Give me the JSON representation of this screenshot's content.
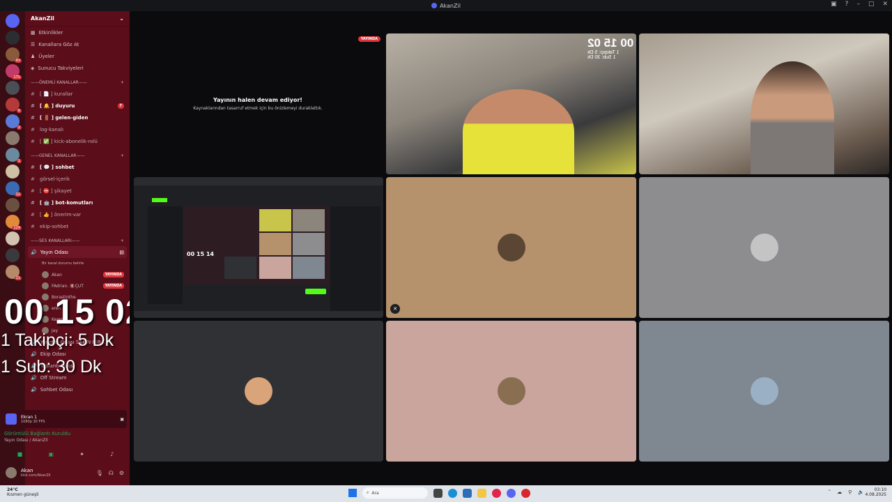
{
  "window": {
    "title": "AkanZil"
  },
  "servers": [
    {
      "badge": ""
    },
    {
      "badge": ""
    },
    {
      "badge": "43"
    },
    {
      "badge": "175"
    },
    {
      "badge": ""
    },
    {
      "badge": "6"
    },
    {
      "badge": "2"
    },
    {
      "badge": ""
    },
    {
      "badge": "1"
    },
    {
      "badge": ""
    },
    {
      "badge": "12"
    },
    {
      "badge": ""
    },
    {
      "badge": "124"
    },
    {
      "badge": ""
    },
    {
      "badge": ""
    },
    {
      "badge": "11"
    }
  ],
  "sidebar": {
    "guild_name": "AkanZil",
    "menu": [
      "Etkinlikler",
      "Kanallara Göz At",
      "Üyeler",
      "Sunucu Takviyeleri"
    ],
    "cat1": "——ÖNEMLİ KANALLAR——",
    "important": [
      {
        "name": "[ 📄 ] kurallar",
        "bold": false
      },
      {
        "name": "[ 🔔 ] duyuru",
        "bold": true,
        "badge": "7"
      },
      {
        "name": "[ 🚪 ] gelen-giden",
        "bold": true
      },
      {
        "name": "log-kanalı",
        "bold": false
      },
      {
        "name": "[ ✅ ] kick-abonelik-rolü",
        "bold": false
      }
    ],
    "cat2": "——GENEL KANALLAR——",
    "general": [
      {
        "name": "[ 💬 ] sohbet",
        "bold": true
      },
      {
        "name": "görsel-içerik",
        "bold": false
      },
      {
        "name": "[ ⛔ ] şikayet",
        "bold": false
      },
      {
        "name": "[ 🤖 ] bot-komutları",
        "bold": true
      },
      {
        "name": "[ 👍 ] önerim-var",
        "bold": false
      },
      {
        "name": "ekip-sohbet",
        "bold": false
      }
    ],
    "cat3": "——SES KANALLARI——",
    "voice_active": "Yayın Odası",
    "voice_status": "Bir kanal durumu belirle",
    "voice_users": [
      {
        "name": "Akan",
        "live": "YAYINDA"
      },
      {
        "name": "FAdrian. 🔇ÇUT",
        "live": "YAYINDA"
      },
      {
        "name": "Borastinthe",
        "live": ""
      },
      {
        "name": "eren",
        "live": ""
      },
      {
        "name": "Kerem",
        "live": ""
      },
      {
        "name": "Jay",
        "live": ""
      }
    ],
    "voice_more": [
      "Yönetici Odası SAKIN GİR...",
      "Ekip Odası",
      "Toplantı Odası",
      "Off Stream",
      "Sohbet Odası"
    ]
  },
  "overlay": {
    "timer": "00 15 02",
    "line1": "1 Takipçi: 5 Dk",
    "line2": "1 Sub: 30 Dk"
  },
  "screen_share": {
    "title": "Ekran 1",
    "sub": "1080p 30 FPS"
  },
  "connection": {
    "status": "Görüntülü Bağlantı Kuruldu",
    "location": "Yayın Odası / AkanZil"
  },
  "user": {
    "name": "Akan",
    "status": "kick.com/AkanZil"
  },
  "stage": {
    "live_label": "YAYINDA",
    "paused_title": "Yayının halen devam ediyor!",
    "paused_sub": "Kaynaklarından tasarruf etmek için bu önizlemeyi duraklattık.",
    "cam_timer": "00 15 02",
    "cam_line1": "1 Takipçi: 5 Dk",
    "cam_line2": "1 Sub: 30 Dk",
    "mini_timer": "00 15 14",
    "tile_colors": {
      "t_brown": "#b5926b",
      "t_grey": "#8d8d8f",
      "t_dark": "#303134",
      "t_pink": "#c9a59d",
      "t_slate": "#7f8790"
    }
  },
  "taskbar": {
    "weather_temp": "24°C",
    "weather_desc": "Kısmen güneşli",
    "search_placeholder": "Ara",
    "time": "03:10",
    "date": "4.08.2025"
  }
}
